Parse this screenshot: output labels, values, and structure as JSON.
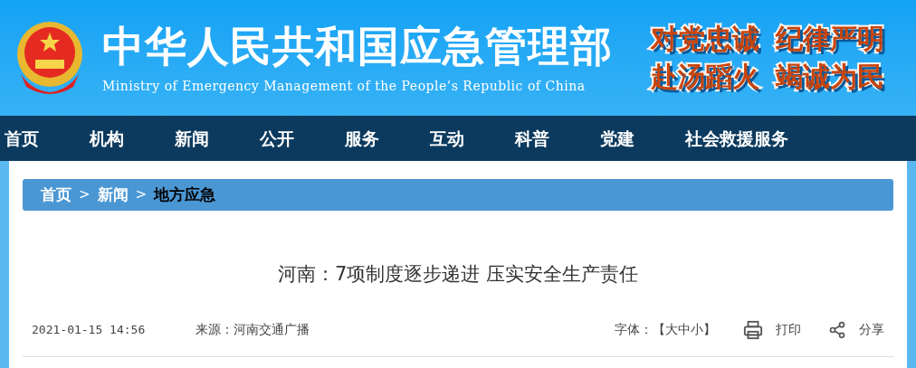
{
  "header": {
    "title": "中华人民共和国应急管理部",
    "subtitle": "Ministry of Emergency Management of the People’s Republic of China",
    "slogans": [
      "对党忠诚",
      "纪律严明",
      "赴汤蹈火",
      "竭诚为民"
    ]
  },
  "nav": [
    {
      "label": "首页"
    },
    {
      "label": "机构"
    },
    {
      "label": "新闻"
    },
    {
      "label": "公开"
    },
    {
      "label": "服务"
    },
    {
      "label": "互动"
    },
    {
      "label": "科普"
    },
    {
      "label": "党建"
    },
    {
      "label": "社会救援服务"
    }
  ],
  "breadcrumb": [
    {
      "label": "首页",
      "selected": false
    },
    {
      "label": ">",
      "kind": "separator"
    },
    {
      "label": "新闻",
      "selected": false
    },
    {
      "label": ">",
      "kind": "separator"
    },
    {
      "label": "地方应急",
      "selected": true
    }
  ],
  "article": {
    "title": "河南：7项制度逐步递进 压实安全生产责任",
    "date": "2021-01-15 14:56",
    "source": "来源：河南交通广播",
    "font_size": "字体：【大中小】",
    "print": "打印",
    "share": "分享"
  }
}
